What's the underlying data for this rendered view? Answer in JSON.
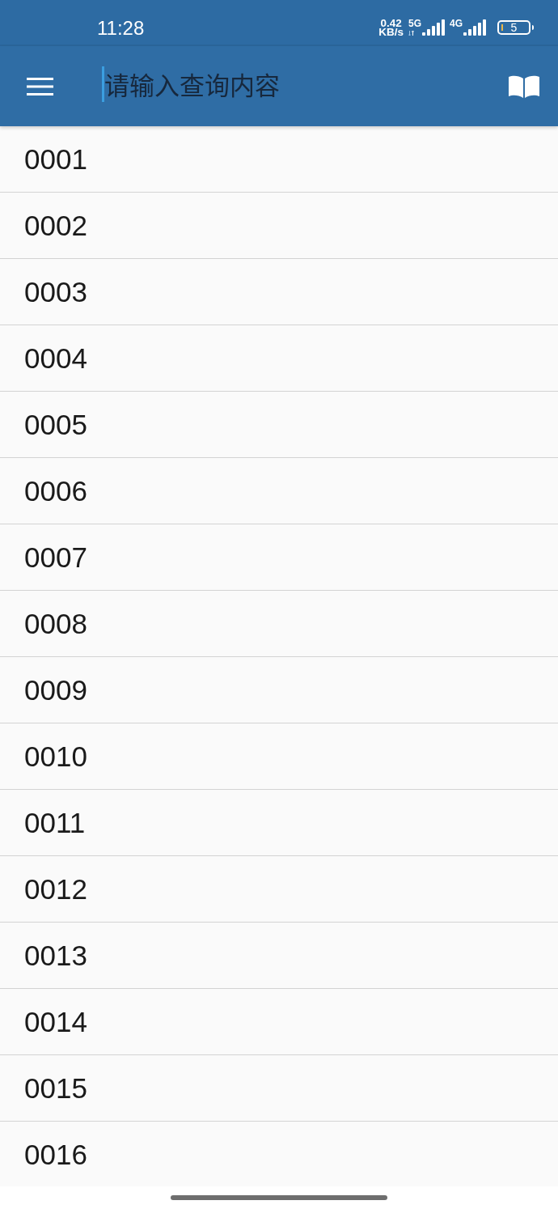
{
  "status_bar": {
    "time": "11:28",
    "network_speed": {
      "value": "0.42",
      "unit": "KB/s"
    },
    "signals": [
      {
        "label": "5G",
        "data_activity": true
      },
      {
        "label": "4G",
        "data_activity": false
      }
    ],
    "battery": "5"
  },
  "app_bar": {
    "search": {
      "placeholder": "请输入查询内容"
    }
  },
  "list": {
    "items": [
      {
        "label": "0001"
      },
      {
        "label": "0002"
      },
      {
        "label": "0003"
      },
      {
        "label": "0004"
      },
      {
        "label": "0005"
      },
      {
        "label": "0006"
      },
      {
        "label": "0007"
      },
      {
        "label": "0008"
      },
      {
        "label": "0009"
      },
      {
        "label": "0010"
      },
      {
        "label": "0011"
      },
      {
        "label": "0012"
      },
      {
        "label": "0013"
      },
      {
        "label": "0014"
      },
      {
        "label": "0015"
      },
      {
        "label": "0016"
      }
    ]
  }
}
